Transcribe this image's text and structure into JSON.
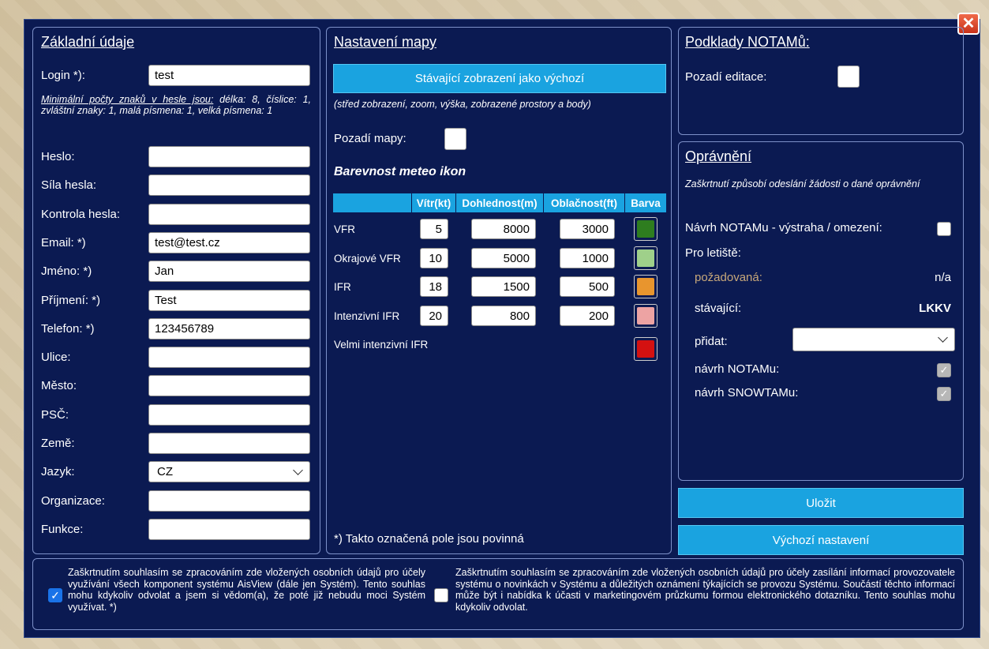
{
  "close_icon": "x-icon",
  "basic": {
    "title": "Základní údaje",
    "login_label": "Login *):",
    "login_value": "test",
    "password_rule_prefix": "Minimální počty znaků v hesle jsou:",
    "password_rule_text": " délka: 8, číslice: 1, zvláštní znaky: 1, malá písmena: 1, velká písmena: 1",
    "fields": [
      {
        "label": "Heslo:",
        "value": ""
      },
      {
        "label": "Síla hesla:",
        "value": ""
      },
      {
        "label": "Kontrola hesla:",
        "value": ""
      },
      {
        "label": "Email: *)",
        "value": "test@test.cz"
      },
      {
        "label": "Jméno: *)",
        "value": "Jan"
      },
      {
        "label": "Příjmení: *)",
        "value": "Test"
      },
      {
        "label": "Telefon: *)",
        "value": "123456789"
      },
      {
        "label": "Ulice:",
        "value": ""
      },
      {
        "label": "Město:",
        "value": ""
      },
      {
        "label": "PSČ:",
        "value": ""
      },
      {
        "label": "Země:",
        "value": ""
      },
      {
        "label": "Jazyk:",
        "value": "CZ"
      },
      {
        "label": "Organizace:",
        "value": ""
      },
      {
        "label": "Funkce:",
        "value": ""
      }
    ]
  },
  "map": {
    "title": "Nastavení mapy",
    "default_view_button": "Stávající zobrazení jako výchozí",
    "default_view_note": "(střed zobrazení, zoom, výška, zobrazené prostory a body)",
    "background_label": "Pozadí mapy:",
    "meteo_title": "Barevnost meteo ikon",
    "columns": [
      "Vítr(kt)",
      "Dohlednost(m)",
      "Oblačnost(ft)",
      "Barva"
    ],
    "rows": [
      {
        "name": "VFR",
        "wind": "5",
        "visibility": "8000",
        "cloud": "3000",
        "color": "#2e7d1f"
      },
      {
        "name": "Okrajové VFR",
        "wind": "10",
        "visibility": "5000",
        "cloud": "1000",
        "color": "#9fd08a"
      },
      {
        "name": "IFR",
        "wind": "18",
        "visibility": "1500",
        "cloud": "500",
        "color": "#e8952e"
      },
      {
        "name": "Intenzivní IFR",
        "wind": "20",
        "visibility": "800",
        "cloud": "200",
        "color": "#eda3a3"
      },
      {
        "name": "Velmi intenzivní IFR",
        "color": "#d41111"
      }
    ],
    "required_note": "*) Takto označená pole jsou povinná"
  },
  "notam": {
    "title": "Podklady NOTAMů:",
    "edit_bg_label": "Pozadí editace:"
  },
  "perm": {
    "title": "Oprávnění",
    "note": "Zaškrtnutí způsobí odeslání žádosti o dané oprávnění",
    "notam_warning_label": "Návrh NOTAMu - výstraha / omezení:",
    "airport_label": "Pro letiště:",
    "requested_label": "požadovaná:",
    "requested_value": "n/a",
    "current_label": "stávající:",
    "current_value": "LKKV",
    "add_label": "přidat:",
    "add_value": "",
    "notam_draft_label": "návrh NOTAMu:",
    "snowtam_draft_label": "návrh SNOWTAMu:"
  },
  "actions": {
    "save": "Uložit",
    "default_settings": "Výchozí nastavení"
  },
  "consent": {
    "left": "Zaškrtnutím souhlasím se zpracováním zde vložených osobních údajů pro účely využívání všech komponent systému AisView (dále jen Systém). Tento souhlas mohu kdykoliv odvolat a jsem si vědom(a), že poté již nebudu moci Systém využívat. *)",
    "left_checked": true,
    "right": "Zaškrtnutím souhlasím se zpracováním zde vložených osobních údajů pro účely zasílání informací provozovatele systému o novinkách v Systému a důležitých oznámení týkajících se provozu Systému. Součástí těchto informací může být i nabídka k účasti v marketingovém průzkumu formou elektronického dotazníku. Tento souhlas mohu kdykoliv odvolat.",
    "right_checked": false
  }
}
